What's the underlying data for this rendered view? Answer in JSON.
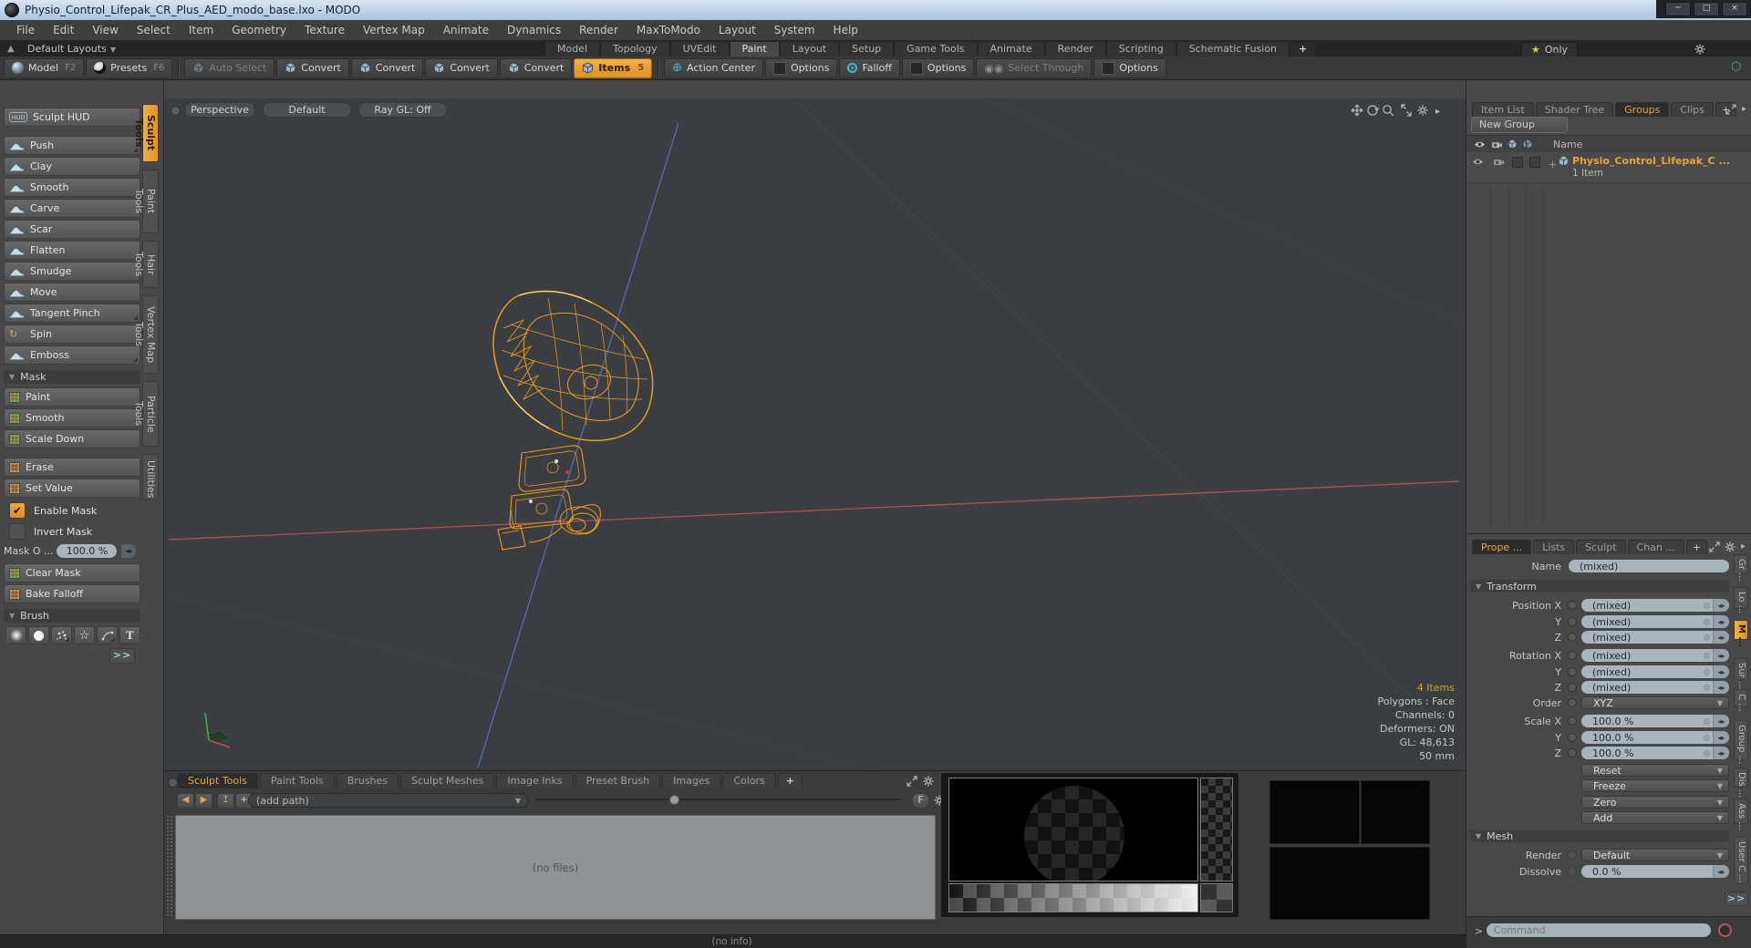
{
  "window": {
    "title": "Physio_Control_Lifepak_CR_Plus_AED_modo_base.lxo - MODO",
    "minimize": "─",
    "maximize": "□",
    "close": "×"
  },
  "menu": {
    "items": [
      "File",
      "Edit",
      "View",
      "Select",
      "Item",
      "Geometry",
      "Texture",
      "Vertex Map",
      "Animate",
      "Dynamics",
      "Render",
      "MaxToModo",
      "Layout",
      "System",
      "Help"
    ]
  },
  "layouts_bar": {
    "switcher": "Default Layouts",
    "tabs": [
      "Model",
      "Topology",
      "UVEdit",
      "Paint",
      "Layout",
      "Setup",
      "Game Tools",
      "Animate",
      "Render",
      "Scripting",
      "Schematic Fusion"
    ],
    "active_tab": "Paint",
    "add_tab": "+",
    "only_label": "Only"
  },
  "toolbar": {
    "model": "Model",
    "model_key": "F2",
    "presets": "Presets",
    "presets_key": "F6",
    "auto_select": "Auto Select",
    "convert": "Convert",
    "items": "Items",
    "items_badge": "5",
    "action_center": "Action Center",
    "options": "Options",
    "falloff": "Falloff",
    "select_through": "Select Through"
  },
  "sidebar": {
    "hud_label": "Sculpt HUD",
    "tools": [
      "Push",
      "Clay",
      "Smooth",
      "Carve",
      "Scar",
      "Flatten",
      "Smudge",
      "Move",
      "Tangent Pinch",
      "Spin",
      "Emboss"
    ],
    "mask_header": "Mask",
    "mask_paint_tools": [
      "Paint",
      "Smooth",
      "Scale Down"
    ],
    "mask_edit_tools": [
      "Erase",
      "Set Value"
    ],
    "enable_mask": "Enable Mask",
    "invert_mask": "Invert Mask",
    "mask_opacity_label": "Mask O ...",
    "mask_opacity_value": "100.0 %",
    "clear_mask": "Clear Mask",
    "bake_falloff": "Bake Falloff",
    "brush_header": "Brush",
    "brush_text_tool": "T",
    "more": ">>",
    "vertical_tabs": [
      "Sculpt Tools",
      "Paint Tools",
      "Hair Tools",
      "Vertex Map Tools",
      "Particle Tools",
      "Utilities"
    ],
    "active_vertical_tab": "Sculpt Tools"
  },
  "viewport": {
    "buttons": [
      "Perspective",
      "Default",
      "Ray GL: Off"
    ],
    "info": {
      "items": "4 Items",
      "polygons": "Polygons : Face",
      "channels": "Channels: 0",
      "deformers": "Deformers: ON",
      "gl": "GL: 48,613",
      "grid_size": "50 mm"
    }
  },
  "groups_panel": {
    "tabs": [
      "Item List",
      "Shader Tree",
      "Groups",
      "Clips"
    ],
    "active_tab": "Groups",
    "add_tab": "+",
    "new_group": "New Group",
    "name_header": "Name",
    "item_name": "Physio_Control_Lifepak_C ...",
    "item_count": "1 Item",
    "row_plus": "+"
  },
  "properties": {
    "tabs": [
      "Prope ...",
      "Lists",
      "Sculpt",
      "Chan ..."
    ],
    "active_tab": "Prope ...",
    "add_tab": "+",
    "name_label": "Name",
    "name_value": "(mixed)",
    "transform_header": "Transform",
    "transform_rows": [
      {
        "label": "Position X",
        "value": "(mixed)"
      },
      {
        "label": "Y",
        "value": "(mixed)"
      },
      {
        "label": "Z",
        "value": "(mixed)"
      },
      {
        "label": "Rotation X",
        "value": "(mixed)"
      },
      {
        "label": "Y",
        "value": "(mixed)"
      },
      {
        "label": "Z",
        "value": "(mixed)"
      }
    ],
    "order": {
      "label": "Order",
      "value": "XYZ"
    },
    "scale_rows": [
      {
        "label": "Scale X",
        "value": "100.0 %"
      },
      {
        "label": "Y",
        "value": "100.0 %"
      },
      {
        "label": "Z",
        "value": "100.0 %"
      }
    ],
    "actions": [
      "Reset",
      "Freeze",
      "Zero",
      "Add"
    ],
    "mesh_header": "Mesh",
    "render_label": "Render",
    "render_value": "Default",
    "dissolve_label": "Dissolve",
    "dissolve_value": "0.0 %",
    "vertical_tabs": [
      "Gr ...",
      "Lo ...",
      "M ...",
      "Sur ...",
      "C ...",
      "Group ...",
      "Dis ...",
      "Ass ...",
      "User C ..."
    ],
    "active_vertical_tab": "M ...",
    "more": ">>"
  },
  "bottom_panel": {
    "tabs": [
      "Sculpt Tools",
      "Paint Tools",
      "Brushes",
      "Sculpt Meshes",
      "Image Inks",
      "Preset Brush",
      "Images",
      "Colors"
    ],
    "active_tab": "Sculpt Tools",
    "add_tab": "+",
    "path_placeholder": "(add path)",
    "no_files": "(no files)",
    "f_button": "F"
  },
  "status_bar": {
    "text": "(no info)"
  },
  "command_bar": {
    "prompt": ">",
    "placeholder": "Command"
  },
  "colors": {
    "accent_orange": "#e8952f",
    "tab_highlight_text": "#e8a33d",
    "model_wireframe": "#f09c17",
    "axis_red": "#b5524a",
    "axis_blue": "#5868b0",
    "field_bg": "#a9b5bc",
    "titlebar_blue": "#b9d0e6",
    "info_gold": "#d7a421"
  }
}
